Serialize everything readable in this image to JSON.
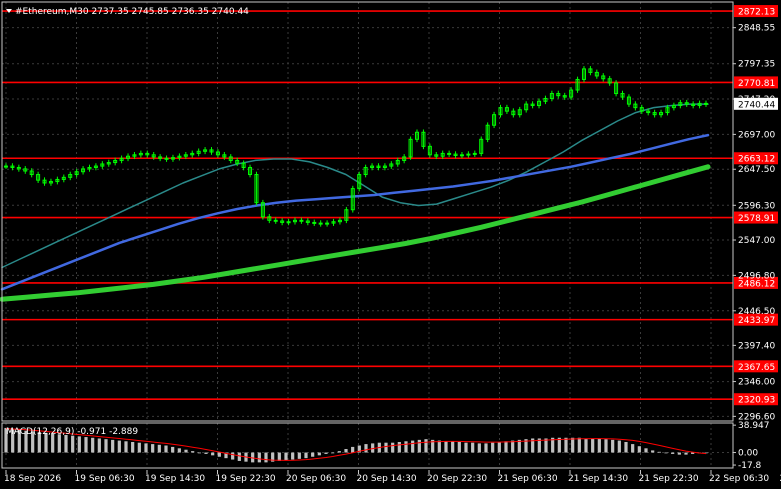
{
  "header": {
    "symbol_line": "#Ethereum,M30  2737.35 2745.85 2736.35 2740.44"
  },
  "colors": {
    "background": "#000000",
    "grid": "#3a3a3a",
    "frame": "#c8c8c8",
    "text": "#ffffff",
    "candle": "#00ff00",
    "level_line": "#ff0000",
    "level_tag": "#ff0000",
    "ma_fast": "#2a8a8a",
    "ma_mid": "#4169e1",
    "ma_slow": "#32cd32",
    "macd_hist": "#c0c0c0",
    "macd_signal": "#ff0000",
    "price_tag_bg": "#ffffff",
    "price_tag_text": "#000000"
  },
  "chart_data": [
    {
      "type": "line",
      "panel": "price",
      "ylim": [
        2290,
        2885
      ],
      "grid": true,
      "y_ticks": [
        "2848.55",
        "2797.35",
        "2747.20",
        "2697.00",
        "2647.50",
        "2596.30",
        "2547.00",
        "2496.80",
        "2446.50",
        "2397.40",
        "2346.00",
        "2296.60"
      ],
      "x_ticks": [
        "18 Sep 2026",
        "19 Sep 06:30",
        "19 Sep 14:30",
        "19 Sep 22:30",
        "20 Sep 06:30",
        "20 Sep 14:30",
        "20 Sep 22:30",
        "21 Sep 06:30",
        "21 Sep 14:30",
        "21 Sep 22:30",
        "22 Sep 06:30",
        "22 Sep 14:30"
      ],
      "current_price": "2740.44",
      "levels": [
        "2872.13",
        "2770.81",
        "2663.12",
        "2578.91",
        "2486.12",
        "2433.97",
        "2367.65",
        "2320.93"
      ],
      "close": [
        2652,
        2650,
        2648,
        2645,
        2640,
        2632,
        2628,
        2630,
        2633,
        2636,
        2640,
        2644,
        2648,
        2650,
        2652,
        2655,
        2657,
        2660,
        2663,
        2666,
        2668,
        2670,
        2668,
        2665,
        2663,
        2662,
        2664,
        2666,
        2668,
        2670,
        2673,
        2675,
        2672,
        2668,
        2665,
        2660,
        2656,
        2650,
        2640,
        2600,
        2580,
        2575,
        2574,
        2572,
        2573,
        2575,
        2574,
        2572,
        2571,
        2570,
        2571,
        2573,
        2575,
        2590,
        2620,
        2640,
        2650,
        2652,
        2650,
        2652,
        2655,
        2660,
        2665,
        2690,
        2700,
        2680,
        2668,
        2666,
        2670,
        2669,
        2667,
        2668,
        2669,
        2670,
        2690,
        2710,
        2725,
        2735,
        2730,
        2725,
        2732,
        2740,
        2738,
        2744,
        2748,
        2755,
        2752,
        2750,
        2760,
        2775,
        2790,
        2785,
        2780,
        2776,
        2770,
        2755,
        2750,
        2740,
        2735,
        2730,
        2728,
        2725,
        2728,
        2735,
        2738,
        2742,
        2740,
        2738,
        2741,
        2740
      ],
      "series": [
        {
          "values": [
            2508,
            2520,
            2532,
            2544,
            2556,
            2568,
            2580,
            2592,
            2604,
            2616,
            2628,
            2638,
            2648,
            2655,
            2660,
            2662,
            2662,
            2658,
            2650,
            2640,
            2624,
            2608,
            2600,
            2596,
            2598,
            2606,
            2614,
            2622,
            2632,
            2644,
            2658,
            2672,
            2688,
            2702,
            2716,
            2728,
            2735,
            2738,
            2740,
            2740
          ]
        },
        {
          "values": [
            2477,
            2488,
            2499,
            2510,
            2521,
            2532,
            2543,
            2552,
            2561,
            2570,
            2578,
            2585,
            2591,
            2596,
            2600,
            2603,
            2605,
            2607,
            2609,
            2611,
            2614,
            2617,
            2620,
            2623,
            2627,
            2631,
            2636,
            2641,
            2646,
            2651,
            2657,
            2663,
            2669,
            2676,
            2683,
            2690,
            2696
          ]
        },
        {
          "values": [
            2463,
            2466,
            2469,
            2472,
            2476,
            2480,
            2484,
            2489,
            2494,
            2500,
            2506,
            2512,
            2518,
            2524,
            2530,
            2536,
            2542,
            2549,
            2557,
            2565,
            2574,
            2583,
            2592,
            2601,
            2611,
            2621,
            2631,
            2641,
            2651
          ]
        }
      ]
    },
    {
      "type": "bar",
      "panel": "macd",
      "title": "MACD(12,26,9) -0.971 -2.889",
      "ylim": [
        -22,
        42
      ],
      "y_ticks": [
        "38.947",
        "0.00",
        "-17.8"
      ],
      "histogram": [
        35,
        34,
        33,
        31,
        30,
        29,
        28,
        27,
        26,
        25,
        24,
        23,
        22,
        21,
        20,
        19,
        18,
        17,
        16,
        15,
        14,
        13,
        12,
        11,
        10,
        8,
        6,
        4,
        2,
        0,
        -2,
        -4,
        -6,
        -8,
        -10,
        -12,
        -13,
        -14,
        -14,
        -14,
        -13,
        -12,
        -11,
        -10,
        -9,
        -8,
        -6,
        -4,
        -2,
        0,
        2,
        5,
        8,
        10,
        12,
        13,
        14,
        14,
        14,
        15,
        16,
        17,
        18,
        19,
        18,
        17,
        16,
        16,
        15,
        14,
        14,
        13,
        13,
        14,
        15,
        16,
        17,
        18,
        19,
        20,
        20,
        20,
        21,
        21,
        21,
        21,
        21,
        20,
        20,
        20,
        19,
        18,
        17,
        15,
        12,
        9,
        6,
        3,
        1,
        -1,
        -2,
        -3,
        -3,
        -2,
        -1,
        0
      ],
      "signal": [
        34,
        33.5,
        33,
        32.4,
        31.6,
        30.8,
        30,
        29.1,
        28.2,
        27.3,
        26.4,
        25.5,
        24.6,
        23.6,
        22.7,
        21.8,
        20.8,
        19.9,
        18.9,
        18,
        17,
        16,
        15,
        14,
        13,
        11.8,
        10.5,
        9.1,
        7.6,
        6,
        4.3,
        2.5,
        0.7,
        -1.2,
        -3,
        -4.8,
        -6.4,
        -7.8,
        -9,
        -10,
        -10.7,
        -11.1,
        -11.2,
        -11,
        -10.6,
        -10,
        -9.2,
        -8.2,
        -7,
        -5.6,
        -4,
        -2.2,
        -0.2,
        1.8,
        3.8,
        5.6,
        7.2,
        8.6,
        9.8,
        10.9,
        11.9,
        12.9,
        13.8,
        14.7,
        15.3,
        15.6,
        15.8,
        15.9,
        15.8,
        15.6,
        15.4,
        15.1,
        14.9,
        14.8,
        14.9,
        15.1,
        15.4,
        15.8,
        16.3,
        16.8,
        17.3,
        17.7,
        18.2,
        18.6,
        19,
        19.3,
        19.6,
        19.7,
        19.8,
        19.8,
        19.7,
        19.4,
        19,
        18.3,
        17.2,
        15.8,
        14.1,
        12.2,
        10.1,
        8,
        5.9,
        3.9,
        2.1,
        0.6,
        -0.6,
        -1.5
      ]
    }
  ]
}
